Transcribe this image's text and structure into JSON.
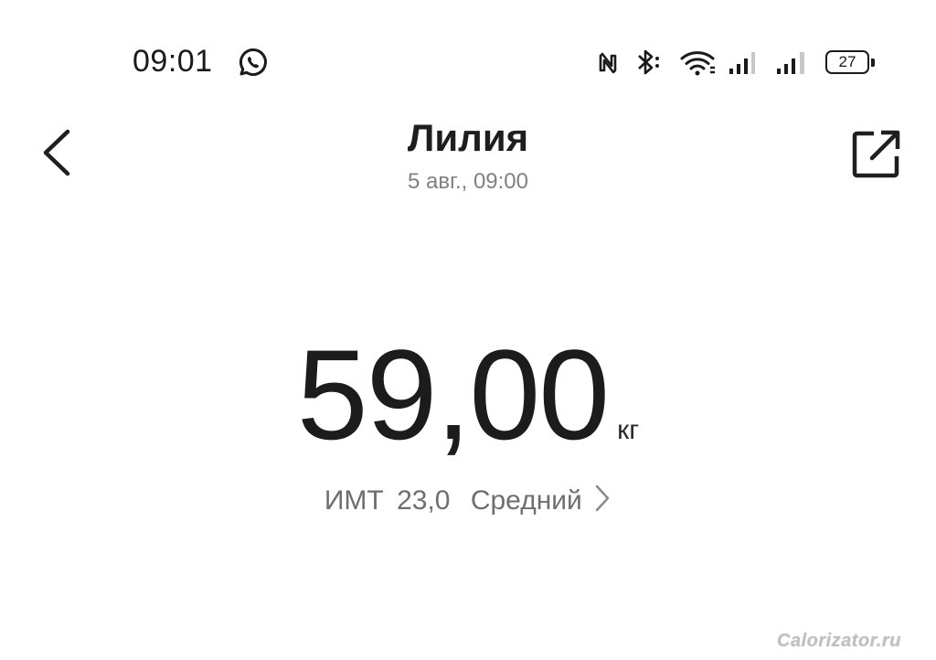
{
  "status_bar": {
    "time": "09:01",
    "battery_level": "27",
    "icons": [
      "whatsapp-icon",
      "nfc-icon",
      "bluetooth-icon",
      "wifi-icon",
      "signal-icon",
      "signal-icon",
      "battery-icon"
    ]
  },
  "header": {
    "title": "Лилия",
    "subtitle": "5 авг., 09:00",
    "back_icon": "chevron-left-icon",
    "share_icon": "share-icon"
  },
  "measurement": {
    "weight": "59,00",
    "unit": "кг",
    "bmi_label": "ИМТ",
    "bmi_value": "23,0",
    "bmi_status": "Средний"
  },
  "watermark": "Calorizator.ru",
  "colors": {
    "background": "#ffffff",
    "text_primary": "#1c1c1c",
    "text_secondary": "#808080"
  }
}
